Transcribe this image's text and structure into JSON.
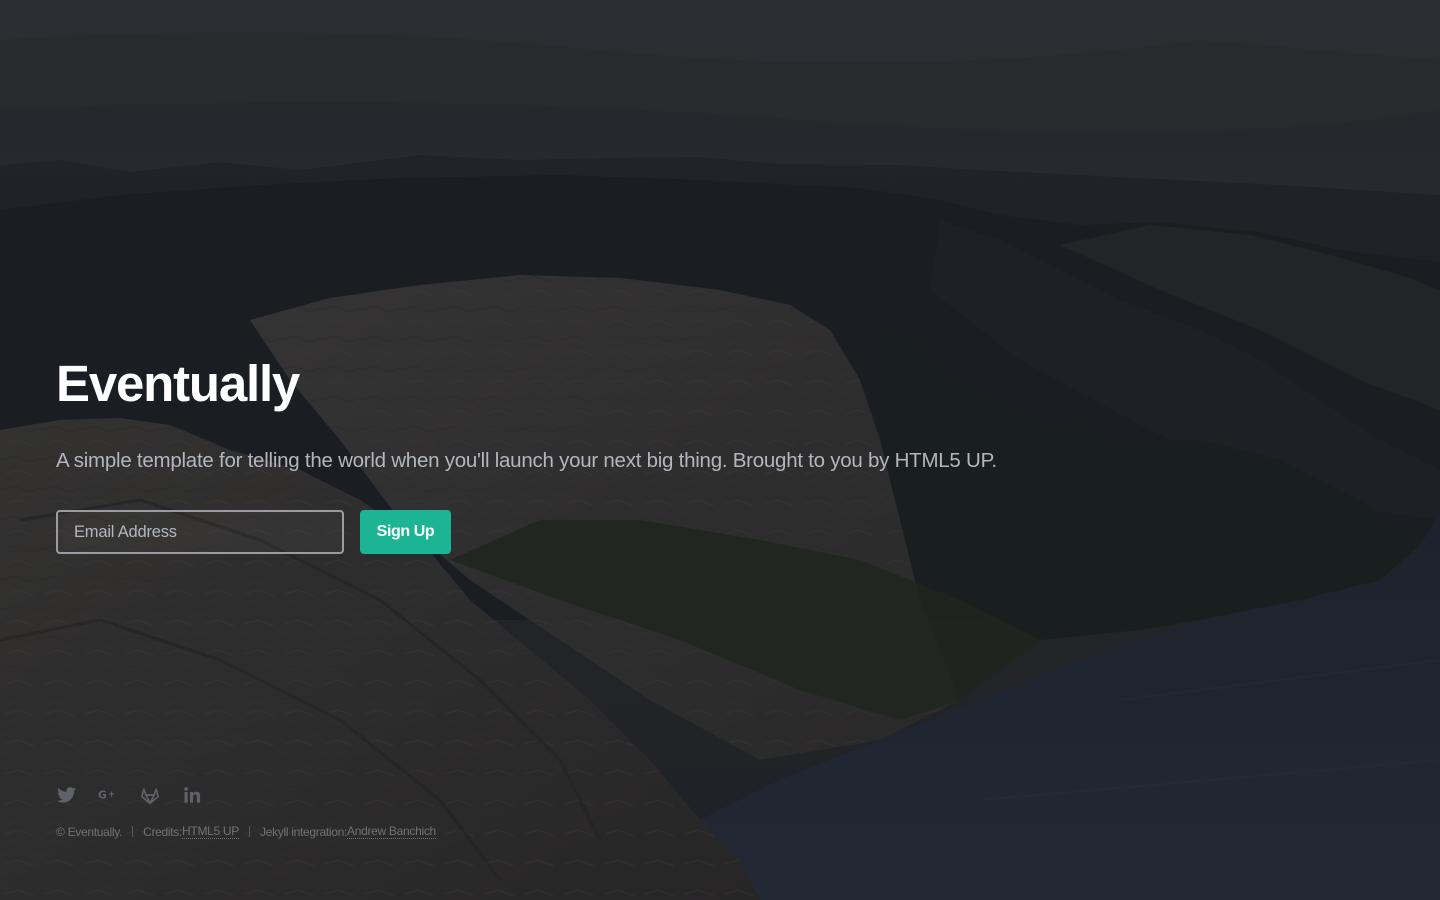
{
  "hero": {
    "title": "Eventually",
    "subtitle": "A simple template for telling the world when you'll launch your next big thing. Brought to you by HTML5 UP."
  },
  "signup": {
    "email_placeholder": "Email Address",
    "email_value": "",
    "button_label": "Sign Up"
  },
  "footer": {
    "social": [
      {
        "name": "twitter",
        "icon": "twitter-icon"
      },
      {
        "name": "google-plus",
        "icon": "google-plus-icon"
      },
      {
        "name": "gitlab",
        "icon": "gitlab-icon"
      },
      {
        "name": "linkedin",
        "icon": "linkedin-icon"
      }
    ],
    "copyright": "© Eventually.",
    "credits_prefix": "Credits: ",
    "credits_link": "HTML5 UP",
    "jekyll_prefix": "Jekyll integration: ",
    "jekyll_link": "Andrew Banchich"
  },
  "colors": {
    "accent": "#1cb495",
    "title": "#ffffff",
    "subtitle": "#b3b6bd",
    "footer_text": "#6f7278",
    "icon": "#5f6268"
  }
}
